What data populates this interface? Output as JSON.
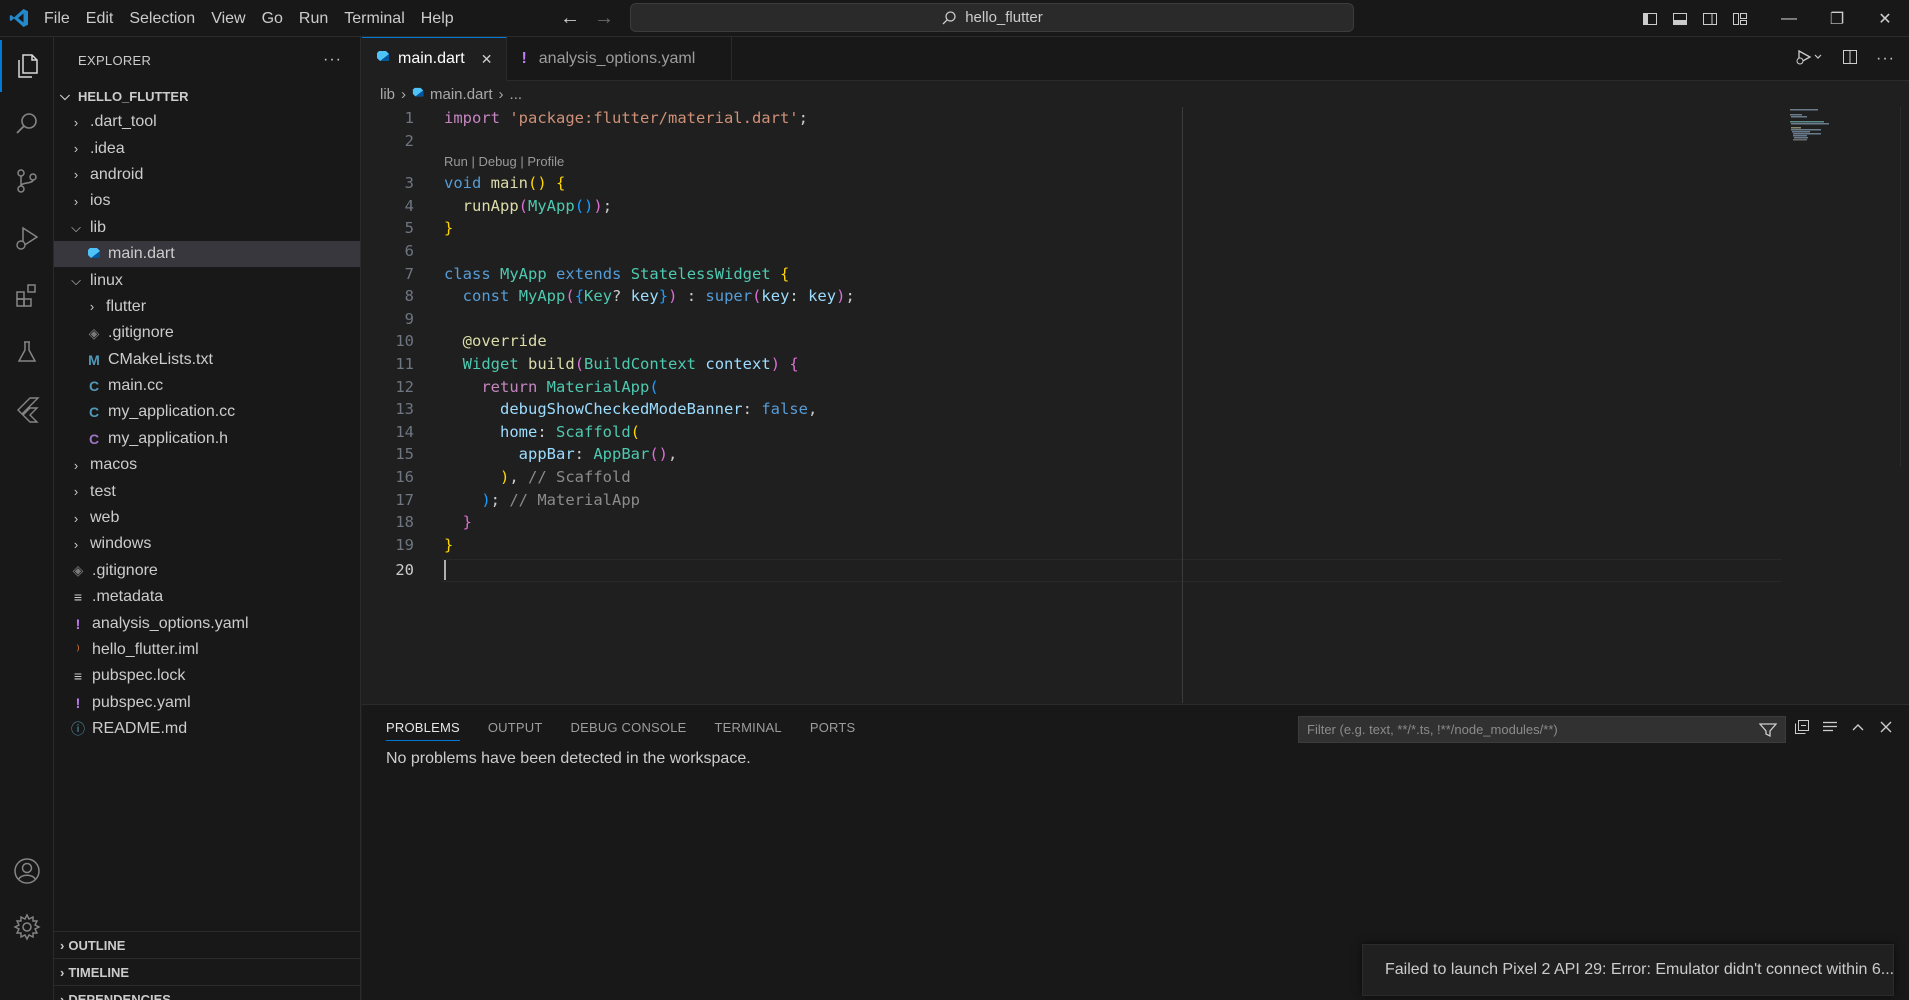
{
  "titlebar": {
    "menu": [
      "File",
      "Edit",
      "Selection",
      "View",
      "Go",
      "Run",
      "Terminal",
      "Help"
    ],
    "search_text": "hello_flutter",
    "minimize": "—",
    "restore": "❐",
    "close": "✕"
  },
  "sidebar": {
    "title": "EXPLORER",
    "more": "···",
    "root": "HELLO_FLUTTER",
    "items": [
      {
        "label": ".dart_tool",
        "depth": 1,
        "type": "folder",
        "open": false
      },
      {
        "label": ".idea",
        "depth": 1,
        "type": "folder",
        "open": false
      },
      {
        "label": "android",
        "depth": 1,
        "type": "folder",
        "open": false
      },
      {
        "label": "ios",
        "depth": 1,
        "type": "folder",
        "open": false
      },
      {
        "label": "lib",
        "depth": 1,
        "type": "folder",
        "open": true
      },
      {
        "label": "main.dart",
        "depth": 2,
        "type": "dart",
        "selected": true
      },
      {
        "label": "linux",
        "depth": 1,
        "type": "folder",
        "open": true
      },
      {
        "label": "flutter",
        "depth": 2,
        "type": "folder",
        "open": false
      },
      {
        "label": ".gitignore",
        "depth": 2,
        "type": "git"
      },
      {
        "label": "CMakeLists.txt",
        "depth": 2,
        "type": "cmake"
      },
      {
        "label": "main.cc",
        "depth": 2,
        "type": "cpp"
      },
      {
        "label": "my_application.cc",
        "depth": 2,
        "type": "cpp"
      },
      {
        "label": "my_application.h",
        "depth": 2,
        "type": "c"
      },
      {
        "label": "macos",
        "depth": 1,
        "type": "folder",
        "open": false
      },
      {
        "label": "test",
        "depth": 1,
        "type": "folder",
        "open": false
      },
      {
        "label": "web",
        "depth": 1,
        "type": "folder",
        "open": false
      },
      {
        "label": "windows",
        "depth": 1,
        "type": "folder",
        "open": false
      },
      {
        "label": ".gitignore",
        "depth": 1,
        "type": "git"
      },
      {
        "label": ".metadata",
        "depth": 1,
        "type": "lines"
      },
      {
        "label": "analysis_options.yaml",
        "depth": 1,
        "type": "yaml"
      },
      {
        "label": "hello_flutter.iml",
        "depth": 1,
        "type": "rss"
      },
      {
        "label": "pubspec.lock",
        "depth": 1,
        "type": "lines"
      },
      {
        "label": "pubspec.yaml",
        "depth": 1,
        "type": "yaml"
      },
      {
        "label": "README.md",
        "depth": 1,
        "type": "info"
      }
    ],
    "sections": [
      "OUTLINE",
      "TIMELINE",
      "DEPENDENCIES"
    ]
  },
  "editor": {
    "tabs": [
      {
        "label": "main.dart",
        "active": true,
        "close": "✕"
      },
      {
        "label": "analysis_options.yaml",
        "active": false
      }
    ],
    "breadcrumbs": [
      "lib",
      "main.dart",
      "..."
    ],
    "codelens": "Run | Debug | Profile",
    "line_numbers": [
      "1",
      "2",
      "3",
      "4",
      "5",
      "6",
      "7",
      "8",
      "9",
      "10",
      "11",
      "12",
      "13",
      "14",
      "15",
      "16",
      "17",
      "18",
      "19",
      "20"
    ]
  },
  "panel": {
    "tabs": [
      "PROBLEMS",
      "OUTPUT",
      "DEBUG CONSOLE",
      "TERMINAL",
      "PORTS"
    ],
    "filter_placeholder": "Filter (e.g. text, **/*.ts, !**/node_modules/**)",
    "message": "No problems have been detected in the workspace."
  },
  "notification": {
    "text": "Failed to launch Pixel 2 API 29: Error: Emulator didn't connect within 6..."
  },
  "colors": {
    "accent": "#0078d4",
    "error": "#f14c4c",
    "dart": "#4fc3f7",
    "yaml": "#c07cf4"
  }
}
